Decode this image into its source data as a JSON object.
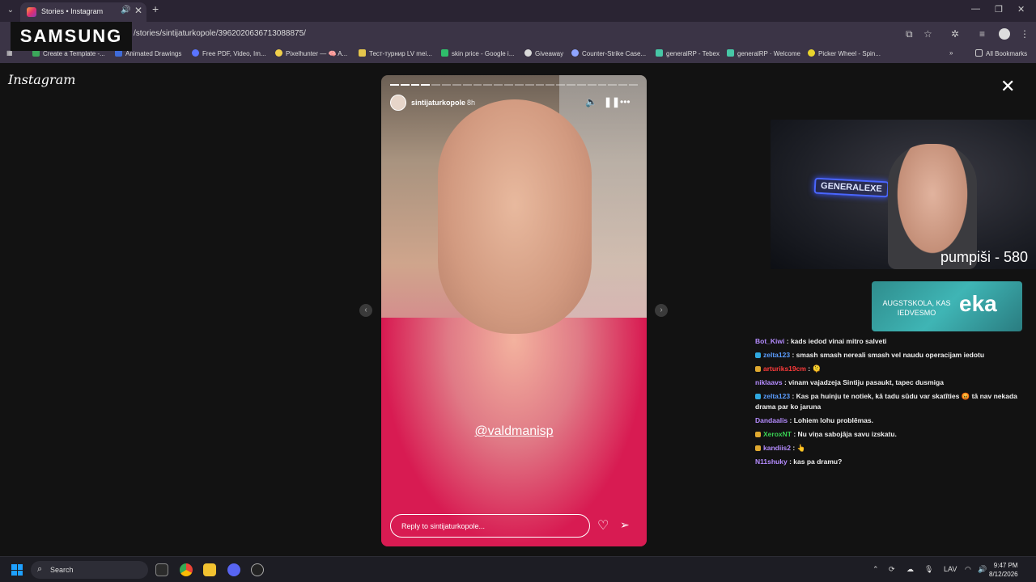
{
  "browser": {
    "tab_title": "Stories • Instagram",
    "url": "/stories/sintijaturkopole/3962020636713088875/",
    "bookmarks": [
      "Create a Template -...",
      "Animated Drawings",
      "Free PDF, Video, Im...",
      "Pixelhunter — 🧠 A...",
      "Тест-турнир LV mei...",
      "skin price - Google i...",
      "Giveaway",
      "Counter-Strike Case...",
      "generalRP - Tebex",
      "generalRP · Welcome",
      "Picker Wheel - Spin..."
    ],
    "all_bookmarks": "All Bookmarks"
  },
  "overlay_brand": "SAMSUNG",
  "instagram": {
    "logo": "Instagram",
    "story": {
      "username": "sintijaturkopole",
      "time": "8h",
      "mention": "@valdmanisp",
      "reply_placeholder": "Reply to sintijaturkopole..."
    }
  },
  "stream": {
    "neon_sign": "GENERALEXE",
    "counter": "pumpiši - 580",
    "banner_text": "AUGSTSKOLA, KAS IEDVESMO",
    "banner_brand": "eka",
    "chat": [
      {
        "user": "Bot_Kiwi",
        "color": "#b58cff",
        "text": ": kads iedod vinai mitro salveti"
      },
      {
        "user": "zelta123",
        "color": "#5b9dff",
        "text": ": smash smash nereali smash vel naudu operacijam iedotu"
      },
      {
        "user": "arturiks19cm",
        "color": "#ff3b3b",
        "text": ": 🫠"
      },
      {
        "user": "niklaavs",
        "color": "#b58cff",
        "text": ": vinam vajadzeja Sintiju pasaukt, tapec dusmiga"
      },
      {
        "user": "zelta123",
        "color": "#5b9dff",
        "text": ": Kas pa huinju te notiek, kā tadu sūdu var skatīties 😡 tā nav nekada drama par ko jaruna"
      },
      {
        "user": "Dandaalis",
        "color": "#b58cff",
        "text": ": Lohiem lohu problēmas."
      },
      {
        "user": "XeroxNT",
        "color": "#39d353",
        "text": ": Nu viņa sabojāja savu izskatu."
      },
      {
        "user": "kandiis2",
        "color": "#b58cff",
        "text": ": 👆"
      },
      {
        "user": "N11shuky",
        "color": "#b58cff",
        "text": ": kas pa dramu?"
      }
    ]
  },
  "taskbar": {
    "search": "Search",
    "lang": "LAV",
    "time": "9:47 PM",
    "date": "8/12/2026"
  }
}
